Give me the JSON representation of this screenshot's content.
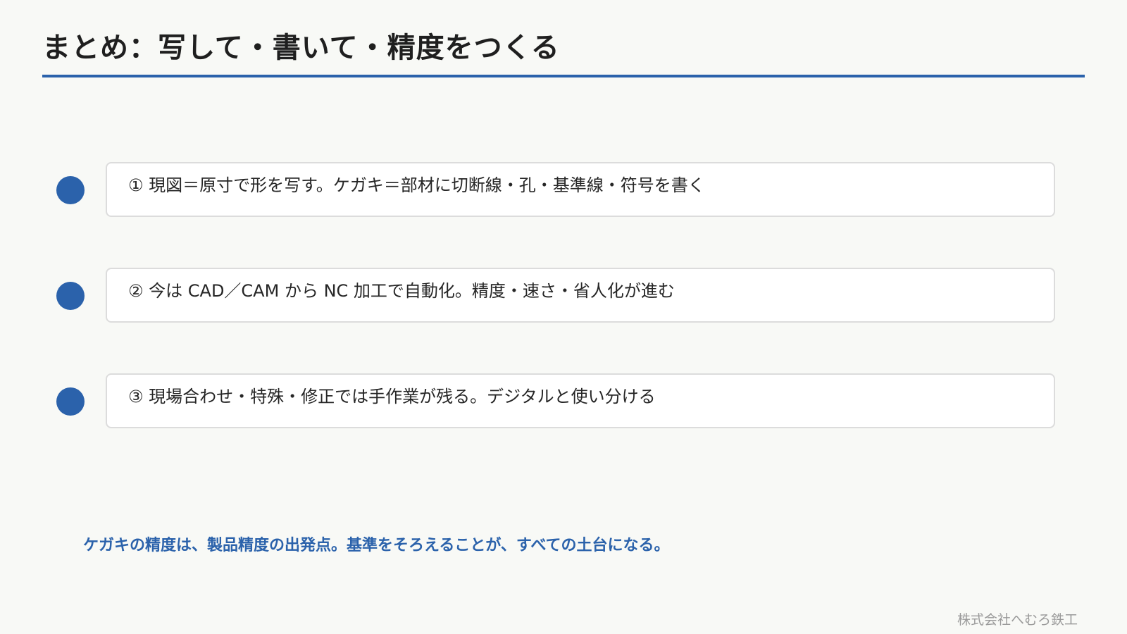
{
  "slide": {
    "title": "まとめ：写して・書いて・精度をつくる",
    "points": [
      {
        "text": "① 現図＝原寸で形を写す。ケガキ＝部材に切断線・孔・基準線・符号を書く"
      },
      {
        "text": "② 今は CAD／CAM から NC 加工で自動化。精度・速さ・省人化が進む"
      },
      {
        "text": "③ 現場合わせ・特殊・修正では手作業が残る。デジタルと使い分ける"
      }
    ],
    "summary": "ケガキの精度は、製品精度の出発点。基準をそろえることが、すべての土台になる。",
    "footer": "株式会社へむろ鉄工"
  },
  "colors": {
    "accent": "#2b62ab",
    "background": "#f8f9f6",
    "card": "#ffffff",
    "card_border": "#dcdcdc",
    "footer_text": "#9a9a9a"
  }
}
